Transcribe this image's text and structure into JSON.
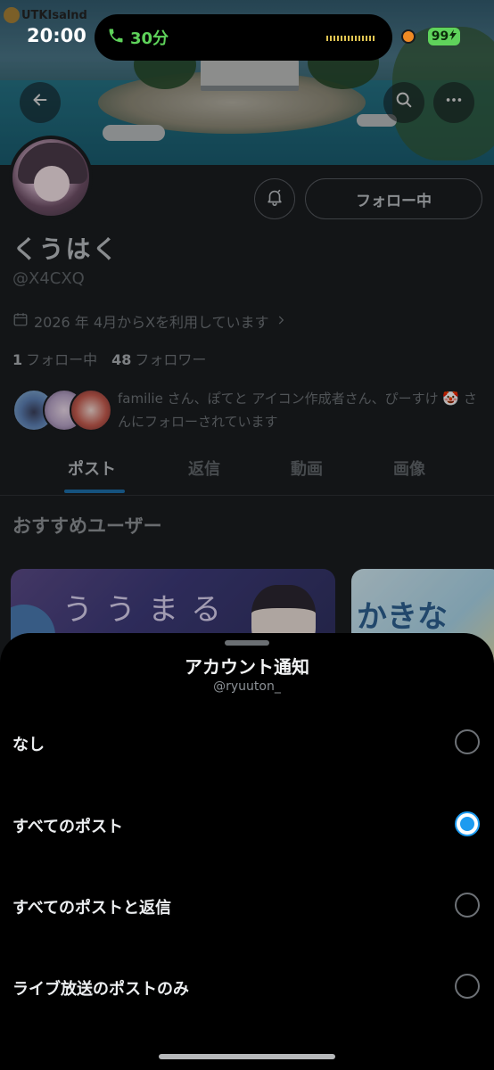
{
  "status_bar": {
    "time": "20:00",
    "call_duration": "30分",
    "battery": "99"
  },
  "banner": {
    "corner_label": "UTKIsalnd"
  },
  "profile": {
    "display_name": "くうはく",
    "handle": "@X4CXQ",
    "joined": "2026 年 4月からXを利用しています",
    "following_count": "1",
    "following_label": "フォロー中",
    "followers_count": "48",
    "followers_label": "フォロワー",
    "follow_button": "フォロー中",
    "mutual_text": "familie さん、ぽてと アイコン作成者さん、ぴーすけ 🤡 さんにフォローされています"
  },
  "tabs": [
    {
      "label": "ポスト",
      "active": true
    },
    {
      "label": "返信",
      "active": false
    },
    {
      "label": "動画",
      "active": false
    },
    {
      "label": "画像",
      "active": false
    }
  ],
  "recommended": {
    "title": "おすすめユーザー",
    "card1_text": "ううまる",
    "card2_text": "かきな"
  },
  "sheet": {
    "title": "アカウント通知",
    "subtitle": "@ryuuton_",
    "options": [
      {
        "label": "なし",
        "selected": false
      },
      {
        "label": "すべてのポスト",
        "selected": true
      },
      {
        "label": "すべてのポストと返信",
        "selected": false
      },
      {
        "label": "ライブ放送のポストのみ",
        "selected": false
      }
    ]
  },
  "colors": {
    "accent": "#1d9bf0",
    "call_green": "#5ed25a",
    "battery_green": "#5fd35b"
  }
}
